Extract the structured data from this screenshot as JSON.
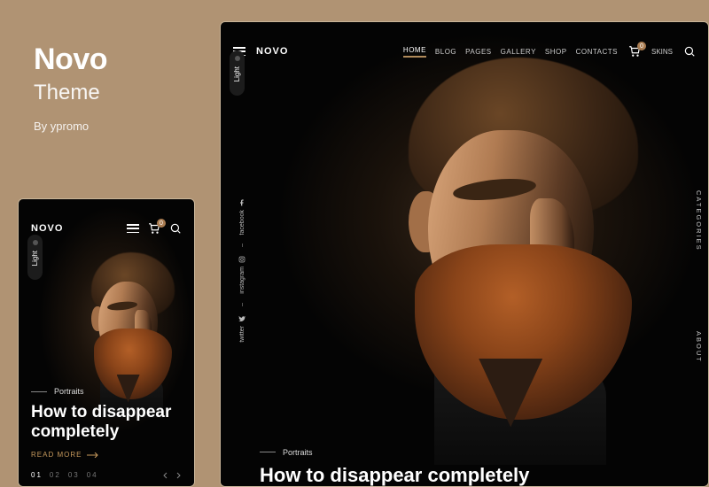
{
  "promo": {
    "title": "Novo",
    "subtitle": "Theme",
    "byline": "By ypromo"
  },
  "brand": "NOVO",
  "nav": {
    "items": [
      "HOME",
      "BLOG",
      "PAGES",
      "GALLERY",
      "SHOP",
      "CONTACTS",
      "SKINS"
    ],
    "active": "HOME"
  },
  "cart_count": "0",
  "light_toggle": "Light",
  "social": {
    "facebook": "facebook",
    "instagram": "instagram",
    "twitter": "twitter"
  },
  "right_rail": {
    "categories": "CATEGORIES",
    "about": "ABOUT"
  },
  "post": {
    "category": "Portraits",
    "headline": "How to disappear completely",
    "read_more": "READ MORE"
  },
  "pager": {
    "current": "01",
    "p2": "02",
    "p3": "03",
    "p4": "04"
  }
}
